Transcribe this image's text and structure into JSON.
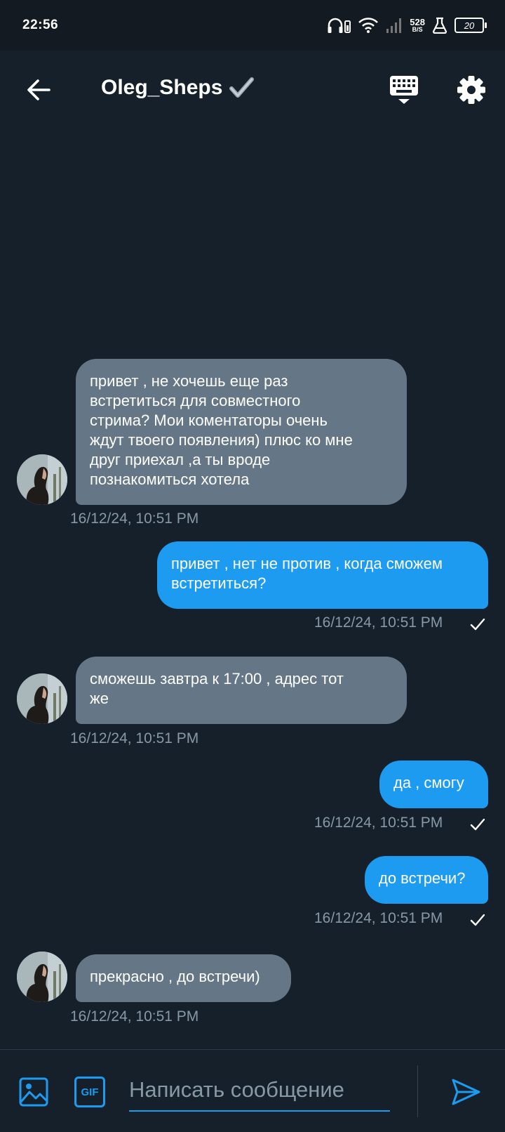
{
  "status_bar": {
    "time": "22:56",
    "net_speed_value": "528",
    "net_speed_unit": "B/S",
    "battery": "20"
  },
  "header": {
    "title": "Oleg_Sheps"
  },
  "messages": [
    {
      "direction": "in",
      "text": "привет , не хочешь еще раз\nвстретиться для совместного\nстрима? Мои коментаторы очень\nждут твоего появления) плюс ко мне\nдруг приехал ,а ты вроде\nпознакомиться хотела",
      "timestamp": "16/12/24, 10:51 PM"
    },
    {
      "direction": "out",
      "text": "привет , нет не против , когда сможем\nвстретиться?",
      "timestamp": "16/12/24, 10:51 PM"
    },
    {
      "direction": "in",
      "text": "сможешь завтра к 17:00 , адрес тот\nже",
      "timestamp": "16/12/24, 10:51 PM"
    },
    {
      "direction": "out",
      "text": "да , смогу",
      "timestamp": "16/12/24, 10:51 PM"
    },
    {
      "direction": "out",
      "text": "до встречи?",
      "timestamp": "16/12/24, 10:51 PM"
    },
    {
      "direction": "in",
      "text": "прекрасно , до встречи)",
      "timestamp": "16/12/24, 10:51 PM"
    }
  ],
  "compose": {
    "placeholder": "Написать сообщение",
    "gif_label": "GIF"
  },
  "colors": {
    "background": "#15202b",
    "incoming_bubble": "#657786",
    "outgoing_bubble": "#1d9bf0",
    "timestamp": "#8899a6",
    "accent": "#1d9bf0"
  },
  "icons": [
    "back-arrow-icon",
    "verified-check-icon",
    "keyboard-icon",
    "gear-icon",
    "image-icon",
    "gif-icon",
    "send-icon",
    "read-check-icon"
  ]
}
